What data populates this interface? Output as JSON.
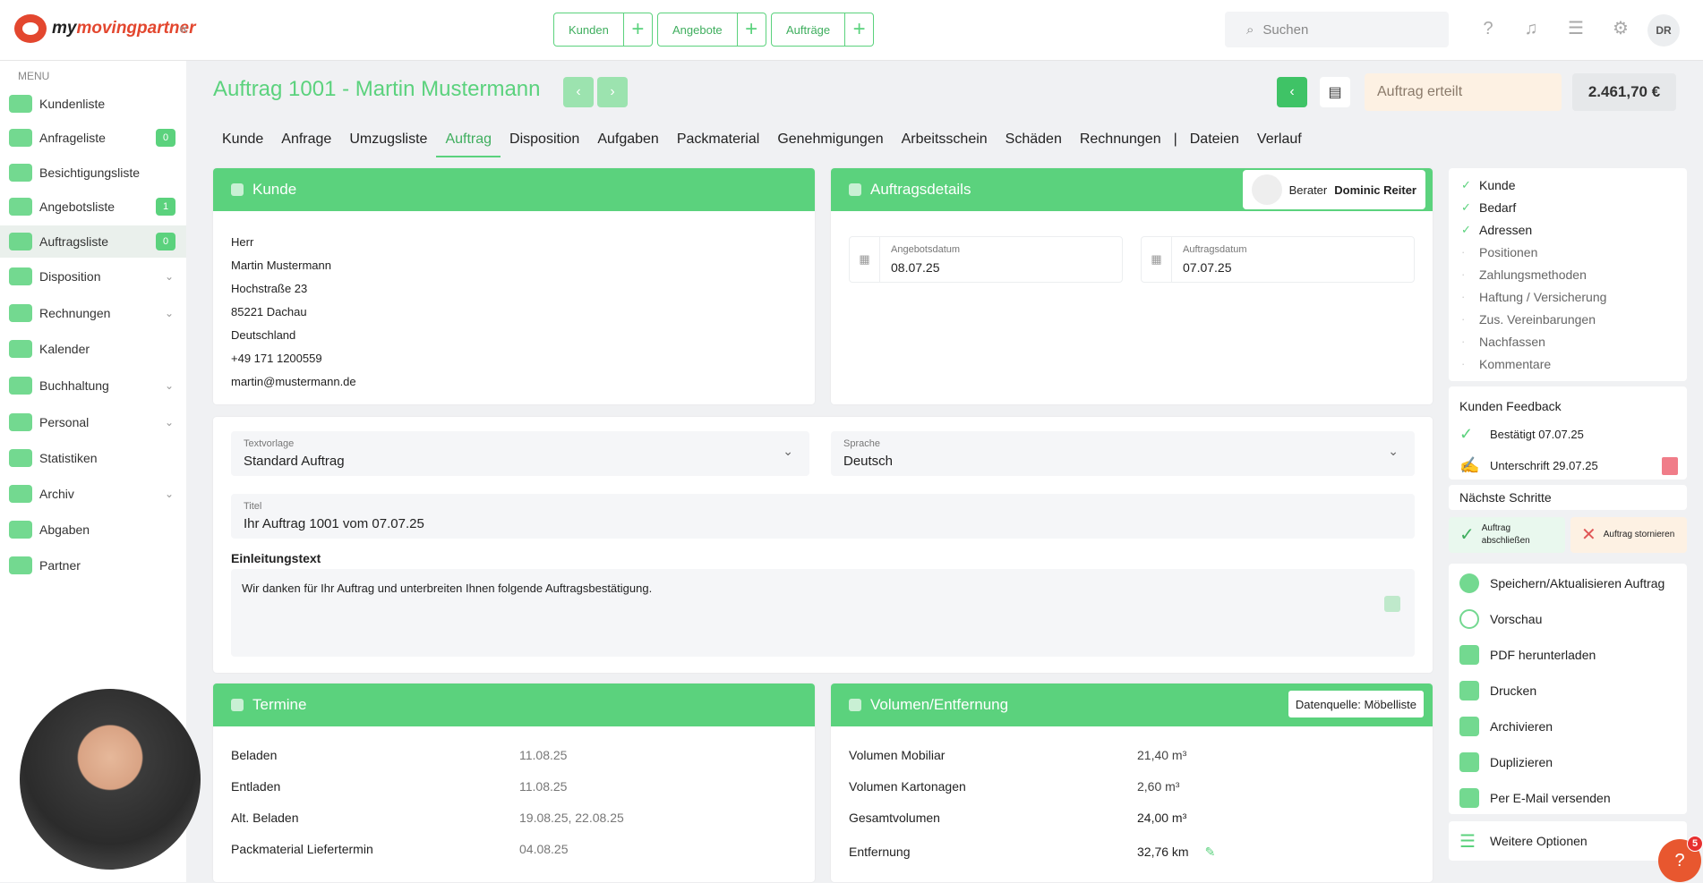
{
  "app": {
    "logo_prefix": "my",
    "logo_main": "movingpartner"
  },
  "quick": [
    {
      "label": "Kunden"
    },
    {
      "label": "Angebote"
    },
    {
      "label": "Aufträge"
    }
  ],
  "search": {
    "placeholder": "Suchen"
  },
  "user": {
    "initials": "DR"
  },
  "sidebar": {
    "menu_label": "MENU",
    "items": [
      {
        "label": "Kundenliste"
      },
      {
        "label": "Anfrageliste",
        "badge": "0"
      },
      {
        "label": "Besichtigungsliste"
      },
      {
        "label": "Angebotsliste",
        "badge": "1"
      },
      {
        "label": "Auftragsliste",
        "badge": "0"
      },
      {
        "label": "Disposition"
      },
      {
        "label": "Rechnungen"
      },
      {
        "label": "Kalender"
      },
      {
        "label": "Buchhaltung"
      },
      {
        "label": "Personal"
      },
      {
        "label": "Statistiken"
      },
      {
        "label": "Archiv"
      },
      {
        "label": "Abgaben"
      },
      {
        "label": "Partner"
      }
    ]
  },
  "header": {
    "title": "Auftrag 1001 - Martin Mustermann",
    "status": "Auftrag erteilt",
    "amount": "2.461,70 €"
  },
  "tabs": [
    "Kunde",
    "Anfrage",
    "Umzugsliste",
    "Auftrag",
    "Disposition",
    "Aufgaben",
    "Packmaterial",
    "Genehmigungen",
    "Arbeitsschein",
    "Schäden",
    "Rechnungen",
    "|",
    "Dateien",
    "Verlauf"
  ],
  "kunde": {
    "title": "Kunde",
    "lines": [
      "Herr",
      "Martin Mustermann",
      "Hochstraße 23",
      "85221 Dachau",
      "Deutschland",
      "+49 171 1200559",
      "martin@mustermann.de"
    ]
  },
  "details": {
    "title": "Auftragsdetails",
    "berater_label": "Berater",
    "berater_name": "Dominic Reiter",
    "angebot_label": "Angebotsdatum",
    "angebot_value": "08.07.25",
    "auftrag_label": "Auftragsdatum",
    "auftrag_value": "07.07.25"
  },
  "text": {
    "vorlage_label": "Textvorlage",
    "vorlage_value": "Standard Auftrag",
    "sprache_label": "Sprache",
    "sprache_value": "Deutsch",
    "titel_label": "Titel",
    "titel_value": "Ihr Auftrag 1001 vom 07.07.25",
    "einleitung_label": "Einleitungstext",
    "einleitung_value": "Wir danken für Ihr Auftrag und unterbreiten Ihnen folgende Auftragsbestätigung."
  },
  "termine": {
    "title": "Termine",
    "rows": [
      {
        "k": "Beladen",
        "v": "11.08.25"
      },
      {
        "k": "Entladen",
        "v": "11.08.25"
      },
      {
        "k": "Alt. Beladen",
        "v": "19.08.25, 22.08.25"
      },
      {
        "k": "Packmaterial Liefertermin",
        "v": "04.08.25"
      }
    ]
  },
  "volumen": {
    "title": "Volumen/Entfernung",
    "source": "Datenquelle: Möbelliste",
    "rows": [
      {
        "k": "Volumen Mobiliar",
        "v": "21,40 m³"
      },
      {
        "k": "Volumen Kartonagen",
        "v": "2,60 m³"
      },
      {
        "k": "Gesamtvolumen",
        "v": "24,00 m³"
      },
      {
        "k": "Entfernung",
        "v": "32,76 km"
      }
    ]
  },
  "checklist": [
    {
      "label": "Kunde",
      "done": true
    },
    {
      "label": "Bedarf",
      "done": true
    },
    {
      "label": "Adressen",
      "done": true
    },
    {
      "label": "Positionen",
      "done": false
    },
    {
      "label": "Zahlungsmethoden",
      "done": false
    },
    {
      "label": "Haftung / Versicherung",
      "done": false
    },
    {
      "label": "Zus. Vereinbarungen",
      "done": false
    },
    {
      "label": "Nachfassen",
      "done": false
    },
    {
      "label": "Kommentare",
      "done": false
    }
  ],
  "feedback": {
    "title": "Kunden Feedback",
    "confirmed": "Bestätigt 07.07.25",
    "signed": "Unterschrift 29.07.25"
  },
  "next": {
    "title": "Nächste Schritte",
    "complete": "Auftrag abschließen",
    "cancel": "Auftrag stornieren"
  },
  "actions": [
    "Speichern/Aktualisieren Auftrag",
    "Vorschau",
    "PDF herunterladen",
    "Drucken",
    "Archivieren",
    "Duplizieren",
    "Per E-Mail versenden"
  ],
  "more": "Weitere Optionen",
  "help": {
    "label": "?",
    "count": "5"
  }
}
